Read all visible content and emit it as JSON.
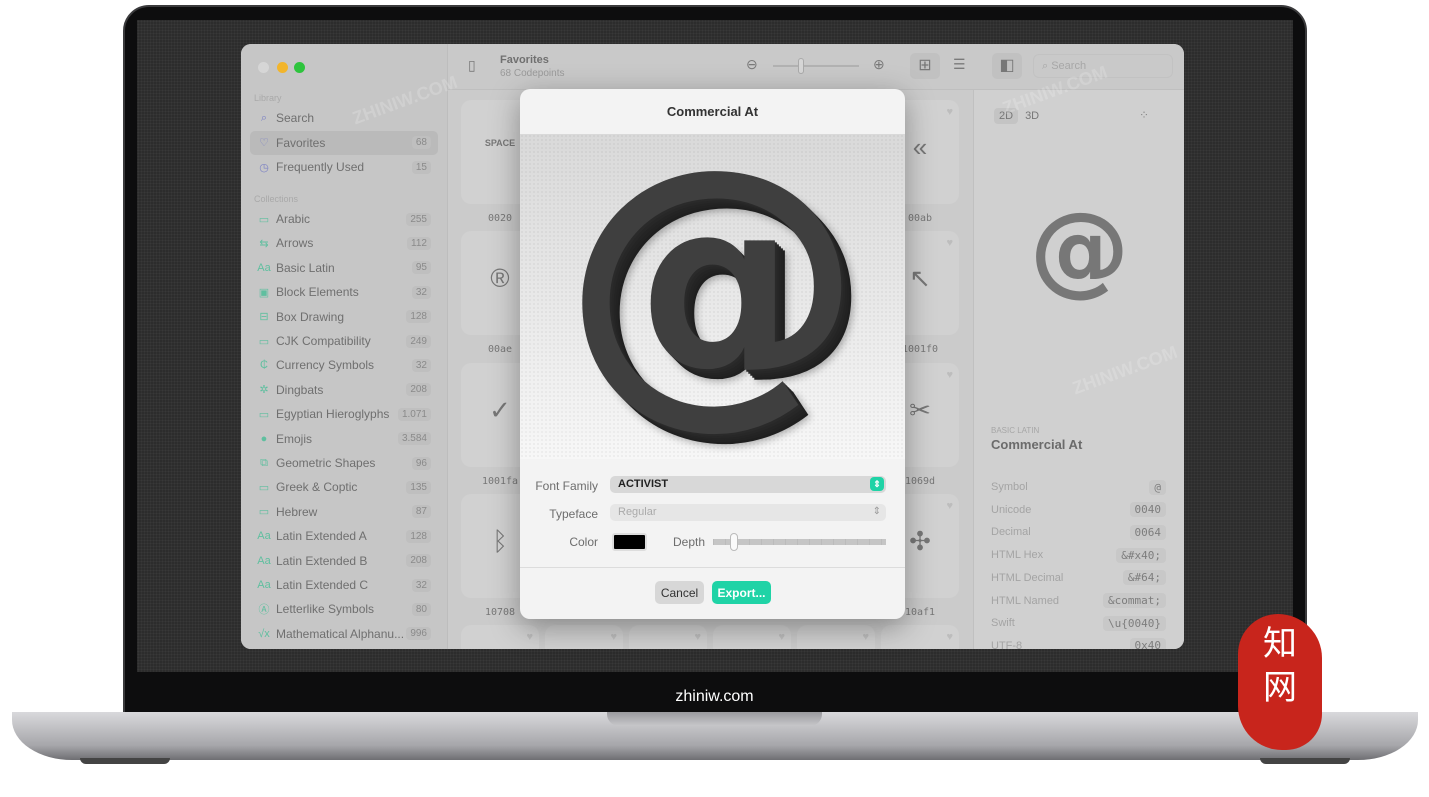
{
  "brand_text": "zhiniw.com",
  "watermark": "ZHINIW.COM",
  "stamp_text": "知网",
  "colors": {
    "accent": "#1fd3a6",
    "sidebar_icon": "#5fbf9f",
    "library_icon": "#7b80c4"
  },
  "sidebar": {
    "library_title": "Library",
    "library": [
      {
        "label": "Search",
        "icon": "search-icon"
      },
      {
        "label": "Favorites",
        "count": "68",
        "icon": "heart-icon",
        "selected": true
      },
      {
        "label": "Frequently Used",
        "count": "15",
        "icon": "clock-icon"
      }
    ],
    "collections_title": "Collections",
    "collections": [
      {
        "label": "Arabic",
        "count": "255",
        "icon": "folder-icon"
      },
      {
        "label": "Arrows",
        "count": "112",
        "icon": "arrows-icon"
      },
      {
        "label": "Basic Latin",
        "count": "95",
        "icon": "text-icon"
      },
      {
        "label": "Block Elements",
        "count": "32",
        "icon": "blocks-icon"
      },
      {
        "label": "Box Drawing",
        "count": "128",
        "icon": "box-icon"
      },
      {
        "label": "CJK Compatibility",
        "count": "249",
        "icon": "folder-icon"
      },
      {
        "label": "Currency Symbols",
        "count": "32",
        "icon": "currency-icon"
      },
      {
        "label": "Dingbats",
        "count": "208",
        "icon": "gear-icon"
      },
      {
        "label": "Egyptian Hieroglyphs",
        "count": "1.071",
        "icon": "folder-icon"
      },
      {
        "label": "Emojis",
        "count": "3.584",
        "icon": "smiley-icon"
      },
      {
        "label": "Geometric Shapes",
        "count": "96",
        "icon": "shapes-icon"
      },
      {
        "label": "Greek & Coptic",
        "count": "135",
        "icon": "folder-icon"
      },
      {
        "label": "Hebrew",
        "count": "87",
        "icon": "folder-icon"
      },
      {
        "label": "Latin Extended A",
        "count": "128",
        "icon": "text-icon"
      },
      {
        "label": "Latin Extended B",
        "count": "208",
        "icon": "text-icon"
      },
      {
        "label": "Latin Extended C",
        "count": "32",
        "icon": "text-icon"
      },
      {
        "label": "Letterlike Symbols",
        "count": "80",
        "icon": "letterlike-icon"
      },
      {
        "label": "Mathematical Alphanu...",
        "count": "996",
        "icon": "sqrt-icon"
      }
    ]
  },
  "toolbar": {
    "title": "Favorites",
    "subtitle": "68 Codepoints",
    "search_placeholder": "Search"
  },
  "grid": {
    "left": [
      {
        "glyph": "SPACE",
        "code": "0020"
      },
      {
        "glyph": "®",
        "code": "00ae"
      },
      {
        "glyph": "✓",
        "code": "1001fa"
      },
      {
        "glyph": "ᛒ",
        "code": "10708"
      }
    ],
    "right": [
      {
        "glyph": "«",
        "code": "00ab"
      },
      {
        "glyph": "↖",
        "code": "1001f0"
      },
      {
        "glyph": "✂",
        "code": "1069d"
      },
      {
        "glyph": "✣",
        "code": "10af1"
      }
    ]
  },
  "panel": {
    "tab_2d": "2D",
    "tab_3d": "3D",
    "symbol": "@",
    "category": "BASIC LATIN",
    "name": "Commercial At",
    "rows": [
      {
        "label": "Symbol",
        "value": "@"
      },
      {
        "label": "Unicode",
        "value": "0040"
      },
      {
        "label": "Decimal",
        "value": "0064"
      },
      {
        "label": "HTML Hex",
        "value": "&#x40;"
      },
      {
        "label": "HTML Decimal",
        "value": "&#64;"
      },
      {
        "label": "HTML Named",
        "value": "&commat;"
      },
      {
        "label": "Swift",
        "value": "\\u{0040}"
      },
      {
        "label": "UTF-8",
        "value": "0x40"
      }
    ]
  },
  "dialog": {
    "title": "Commercial At",
    "preview_glyph": "@",
    "font_family_label": "Font Family",
    "font_family": "ACTIVIST",
    "typeface_label": "Typeface",
    "typeface": "Regular",
    "color_label": "Color",
    "color_value": "#000000",
    "depth_label": "Depth",
    "depth": 0.1,
    "cancel": "Cancel",
    "export": "Export..."
  }
}
